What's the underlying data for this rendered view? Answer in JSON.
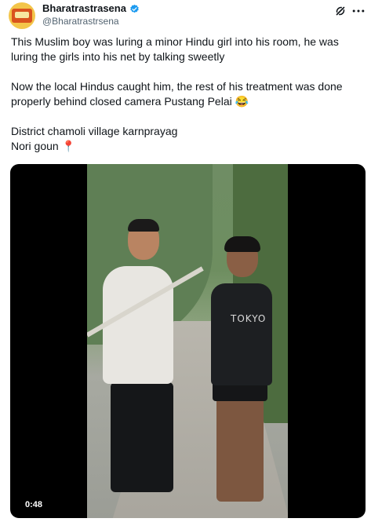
{
  "post": {
    "author_name": "Bharatrastrasena",
    "author_handle": "@Bharatrastrsena",
    "text": "This Muslim boy was luring a minor Hindu girl into his room, he was luring the girls into his net by talking sweetly\n\nNow the local Hindus caught him, the rest of his treatment was done properly behind closed camera Pustang Pelai 😂\n\nDistrict chamoli village karnprayag\nNori goun 📍",
    "shirt_text": "TOKYO"
  },
  "video": {
    "time": "0:48"
  },
  "colors": {
    "verified": "#1d9bf0",
    "text": "#0f1419",
    "secondary": "#536471"
  },
  "icons": {
    "verified": "verified-badge-icon",
    "grok": "grok-icon",
    "more": "more-icon"
  }
}
